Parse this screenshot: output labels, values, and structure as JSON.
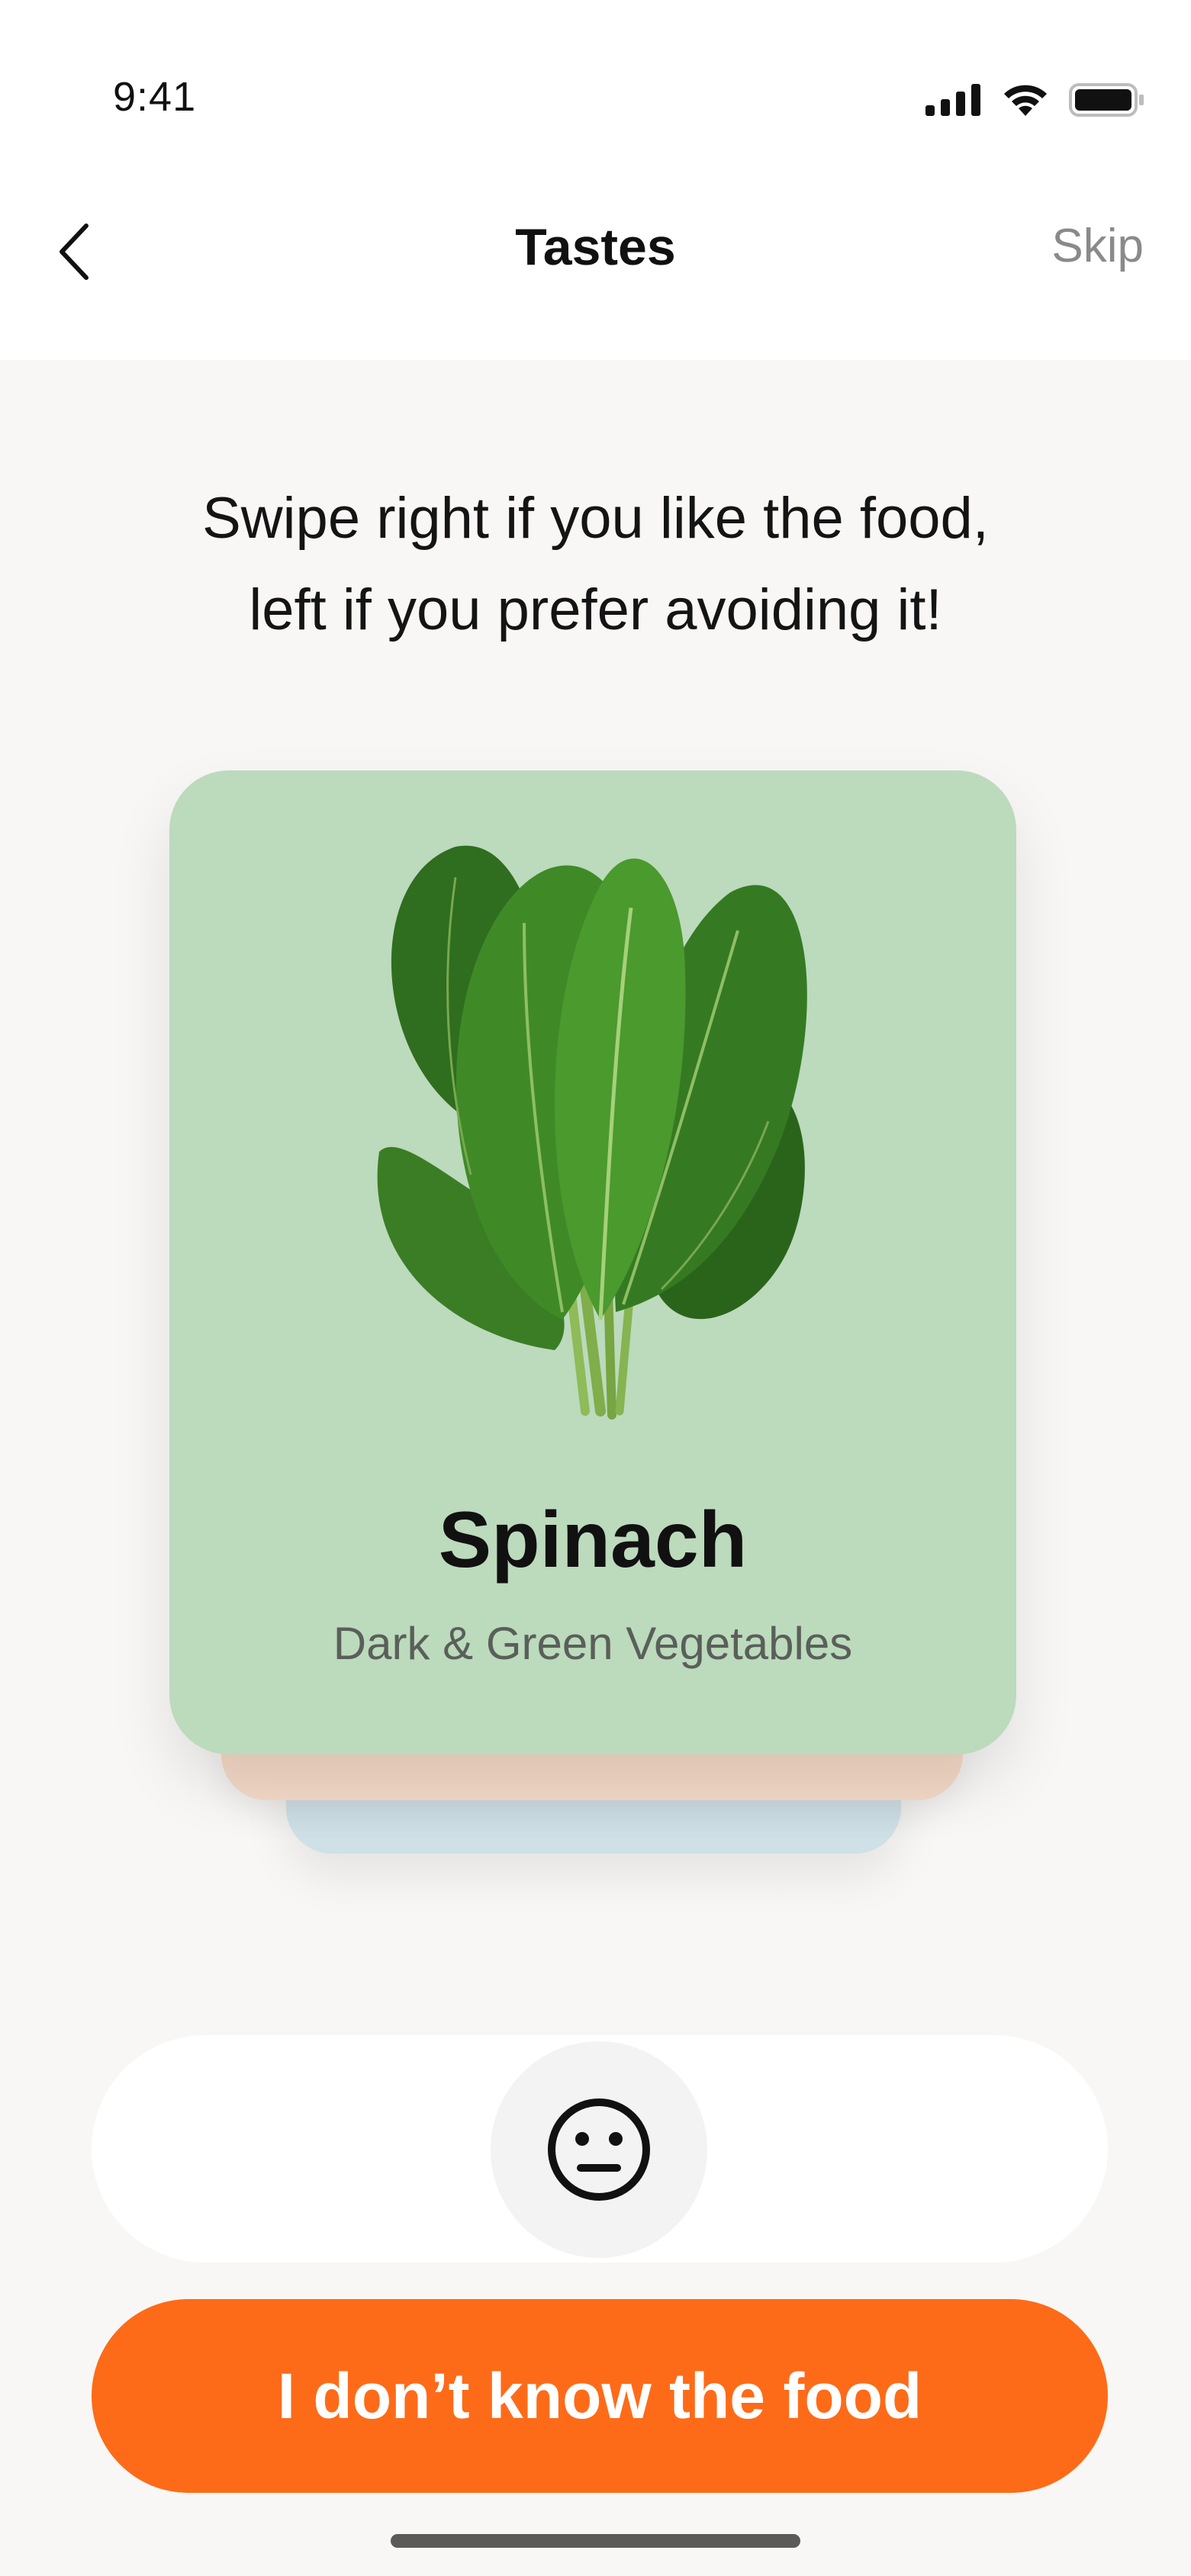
{
  "status_bar": {
    "time": "9:41",
    "icons": [
      "cellular-signal-icon",
      "wifi-icon",
      "battery-icon"
    ]
  },
  "nav": {
    "back_icon": "chevron-left-icon",
    "title": "Tastes",
    "skip_label": "Skip"
  },
  "instruction": {
    "line1": "Swipe right if you like the food,",
    "line2": "left if you prefer avoiding it!"
  },
  "card": {
    "image_icon": "spinach-leaves-image",
    "name": "Spinach",
    "category": "Dark & Green Vegetables",
    "color": "#bcdabc"
  },
  "stack": {
    "mid_color": "#f4d9c6",
    "back_color": "#cfe0e7"
  },
  "rating": {
    "icon": "neutral-face-icon"
  },
  "cta": {
    "label": "I don’t know the food",
    "color": "#fd6b18"
  }
}
